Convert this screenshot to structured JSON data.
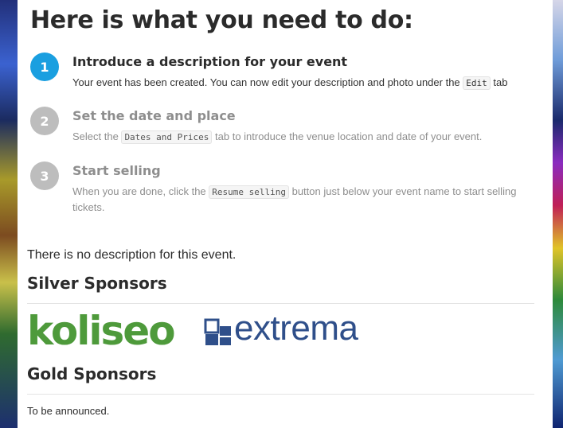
{
  "page": {
    "heading": "Here is what you need to do:",
    "steps": [
      {
        "number": "1",
        "title": "Introduce a description for your event",
        "desc_before": "Your event has been created. You can now edit your description and photo under the ",
        "code": "Edit",
        "desc_after": " tab",
        "active": true
      },
      {
        "number": "2",
        "title": "Set the date and place",
        "desc_before": "Select the ",
        "code": "Dates and Prices",
        "desc_after": " tab to introduce the venue location and date of your event.",
        "active": false
      },
      {
        "number": "3",
        "title": "Start selling",
        "desc_before": "When you are done, click the ",
        "code": "Resume selling",
        "desc_after": " button just below your event name to start selling tickets.",
        "active": false
      }
    ],
    "no_description": "There is no description for this event.",
    "silver_title": "Silver Sponsors",
    "silver_sponsors": [
      {
        "name": "koliseo",
        "color": "#4e9a3b"
      },
      {
        "name": "extrema",
        "color": "#2f4f8a"
      }
    ],
    "gold_title": "Gold Sponsors",
    "gold_text": "To be announced."
  },
  "colors": {
    "accent": "#1a9fe0",
    "inactive": "#bdbdbd"
  }
}
